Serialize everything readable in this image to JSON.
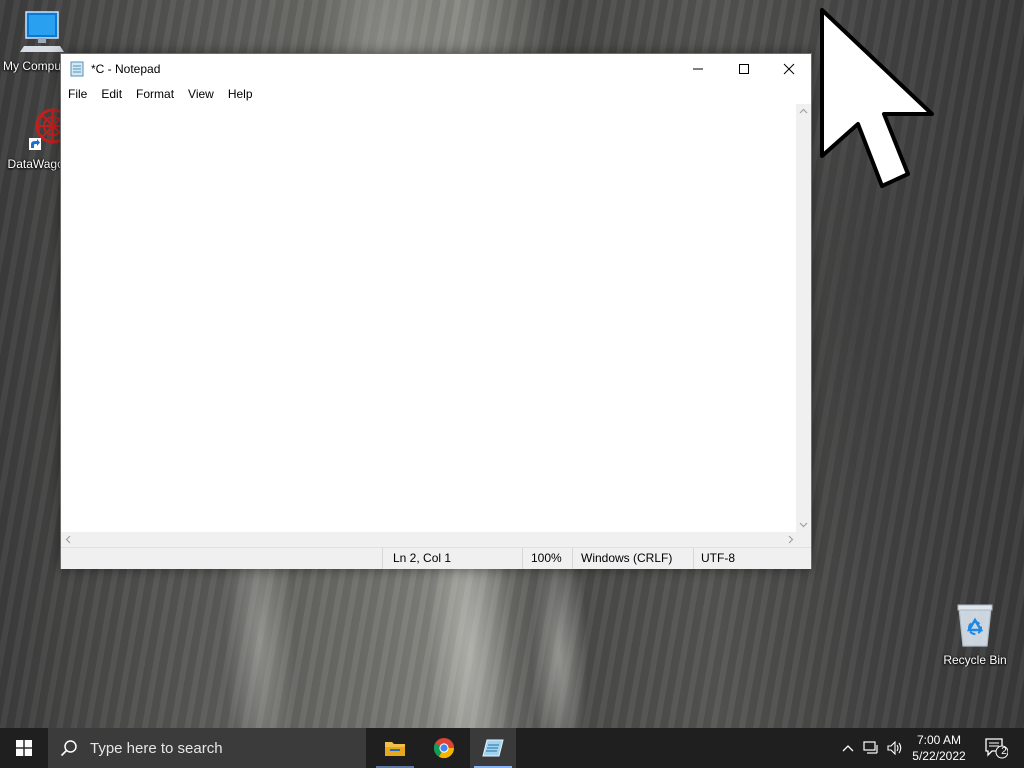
{
  "desktop": {
    "icons": [
      {
        "label": "My Computer",
        "icon": "computer-icon"
      },
      {
        "label": "DataWagon",
        "icon": "datawagon-shortcut-icon"
      },
      {
        "label": "Recycle Bin",
        "icon": "recycle-bin-icon"
      }
    ]
  },
  "window": {
    "title": "*C - Notepad",
    "menu": [
      "File",
      "Edit",
      "Format",
      "View",
      "Help"
    ],
    "editor_text": "",
    "status": {
      "position": "Ln 2, Col 1",
      "zoom": "100%",
      "line_endings": "Windows (CRLF)",
      "encoding": "UTF-8"
    }
  },
  "taskbar": {
    "search_placeholder": "Type here to search",
    "apps": [
      {
        "name": "File Explorer",
        "icon": "folder-icon"
      },
      {
        "name": "Google Chrome",
        "icon": "chrome-icon"
      },
      {
        "name": "Notepad",
        "icon": "notepad-icon",
        "active": true
      }
    ],
    "clock_time": "7:00 AM",
    "clock_date": "5/22/2022",
    "notification_count": "2"
  },
  "colors": {
    "taskbar_bg": "#1f1f1f",
    "search_bg": "#3b3b3b",
    "window_bg": "#ffffff",
    "statusbar_bg": "#f0f0f0"
  }
}
